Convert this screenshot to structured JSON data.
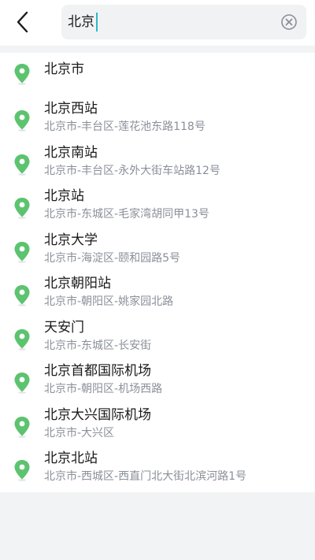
{
  "header": {
    "back_icon": "chevron-left-icon",
    "search": {
      "value": "北京",
      "clear_icon": "clear-circle-icon"
    }
  },
  "colors": {
    "pin_green": "#5cc36f",
    "caret": "#2db7c9",
    "address_gray": "#8a8f99"
  },
  "results": [
    {
      "name": "北京市",
      "address": ""
    },
    {
      "name": "北京西站",
      "address": "北京市-丰台区-莲花池东路118号"
    },
    {
      "name": "北京南站",
      "address": "北京市-丰台区-永外大街车站路12号"
    },
    {
      "name": "北京站",
      "address": "北京市-东城区-毛家湾胡同甲13号"
    },
    {
      "name": "北京大学",
      "address": "北京市-海淀区-颐和园路5号"
    },
    {
      "name": "北京朝阳站",
      "address": "北京市-朝阳区-姚家园北路"
    },
    {
      "name": "天安门",
      "address": "北京市-东城区-长安街"
    },
    {
      "name": "北京首都国际机场",
      "address": "北京市-朝阳区-机场西路"
    },
    {
      "name": "北京大兴国际机场",
      "address": "北京市-大兴区"
    },
    {
      "name": "北京北站",
      "address": "北京市-西城区-西直门北大街北滨河路1号"
    }
  ]
}
